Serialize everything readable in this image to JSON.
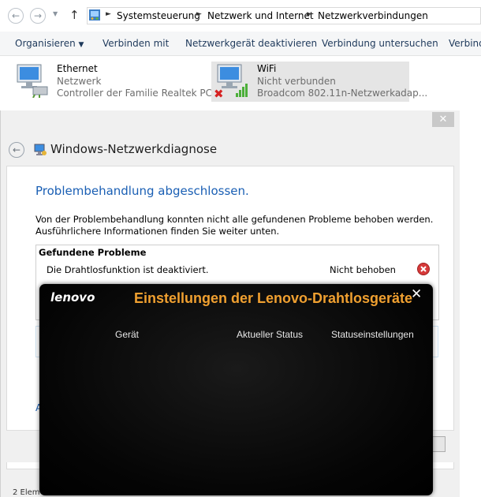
{
  "address": {
    "crumbs": [
      "Systemsteuerung",
      "Netzwerk und Internet",
      "Netzwerkverbindungen"
    ]
  },
  "toolbar": {
    "organize": "Organisieren",
    "connect": "Verbinden mit",
    "disable": "Netzwerkgerät deaktivieren",
    "diagnose": "Verbindung untersuchen",
    "more": "Verbind"
  },
  "adapters": [
    {
      "name": "Ethernet",
      "status": "Netzwerk",
      "device": "Controller der Familie Realtek PCI..."
    },
    {
      "name": "WiFi",
      "status": "Nicht verbunden",
      "device": "Broadcom 802.11n-Netzwerkadap..."
    }
  ],
  "diagnosis": {
    "title": "Windows-Netzwerkdiagnose",
    "heading": "Problembehandlung abgeschlossen.",
    "text1": "Von der Problembehandlung konnten nicht alle gefundenen Probleme behoben werden.",
    "text2": "Ausführlichere Informationen finden Sie weiter unten.",
    "table_header": "Gefundene Probleme",
    "problem": "Die Drahtlosfunktion ist deaktiviert.",
    "problem_status": "Nicht behoben",
    "link_partial": "A"
  },
  "statusbar": {
    "items": "2 Elem"
  },
  "lenovo": {
    "logo": "lenovo",
    "title": "Einstellungen der Lenovo-Drahtlosgeräte",
    "col_device": "Gerät",
    "col_status": "Aktueller Status",
    "col_settings": "Statuseinstellungen"
  },
  "colors": {
    "accent": "#1a5fb4",
    "lenovo_title": "#f0a030",
    "error": "#d63a3a"
  }
}
